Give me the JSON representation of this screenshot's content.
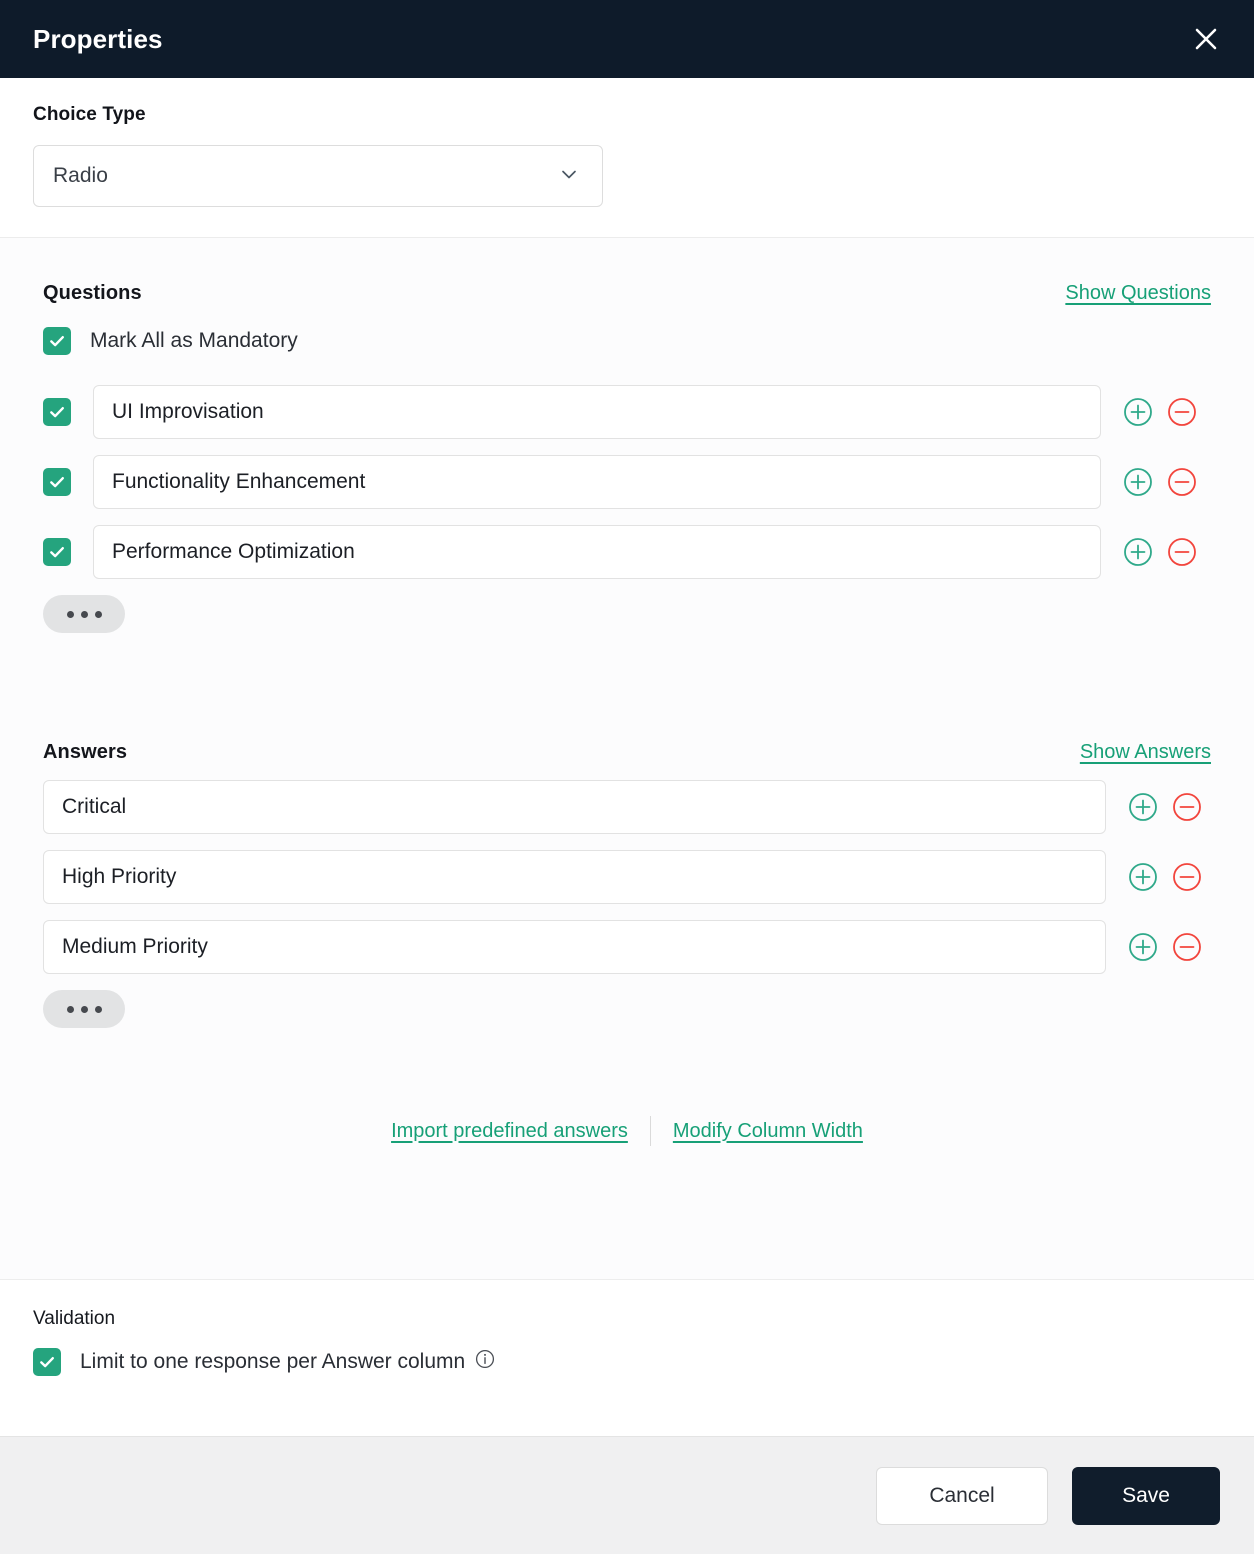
{
  "header": {
    "title": "Properties",
    "close_icon": "close-icon"
  },
  "choice_type": {
    "label": "Choice Type",
    "selected": "Radio",
    "chevron_icon": "chevron-down-icon"
  },
  "questions": {
    "title": "Questions",
    "show_link": "Show Questions",
    "mandatory": {
      "label": "Mark All as Mandatory",
      "checked": true
    },
    "items": [
      {
        "value": "UI Improvisation",
        "checked": true
      },
      {
        "value": "Functionality Enhancement",
        "checked": true
      },
      {
        "value": "Performance Optimization",
        "checked": true
      }
    ],
    "more_label": "•••"
  },
  "answers": {
    "title": "Answers",
    "show_link": "Show Answers",
    "items": [
      {
        "value": "Critical"
      },
      {
        "value": "High Priority"
      },
      {
        "value": "Medium Priority"
      }
    ],
    "more_label": "•••"
  },
  "bottom_links": {
    "import_answers": "Import predefined answers",
    "modify_column_width": "Modify Column Width"
  },
  "validation": {
    "title": "Validation",
    "limit_label": "Limit to one response per Answer column",
    "limit_checked": true,
    "info_icon": "info-icon"
  },
  "footer": {
    "cancel_label": "Cancel",
    "save_label": "Save"
  },
  "colors": {
    "header_bg": "#0E1B2A",
    "accent_teal": "#17A077",
    "checkbox_green": "#25A47E",
    "add_green": "#2FA98A",
    "remove_red": "#F2453D",
    "save_bg": "#101D2C",
    "footer_bg": "#F0F0F1"
  },
  "icons": {
    "add": "plus-circle-icon",
    "remove": "minus-circle-icon",
    "check": "check-icon",
    "ellipsis": "ellipsis-icon"
  }
}
